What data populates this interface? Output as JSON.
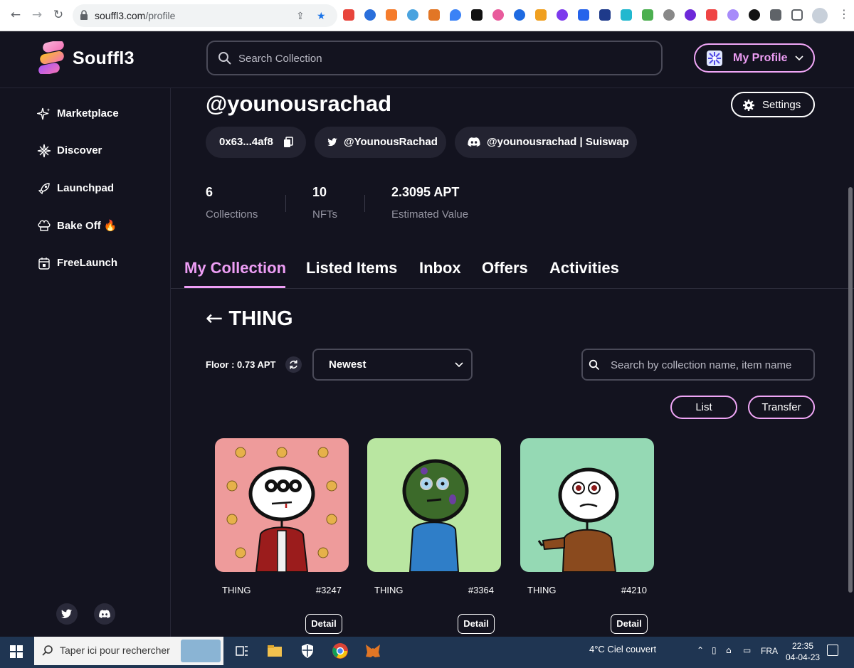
{
  "browser": {
    "url_host": "souffl3.com",
    "url_path": "/profile"
  },
  "header": {
    "logo_text": "Souffl3",
    "search_placeholder": "Search Collection",
    "profile_label": "My Profile"
  },
  "sidebar": {
    "items": [
      {
        "label": "Marketplace",
        "icon": "sparkle-icon"
      },
      {
        "label": "Discover",
        "icon": "compass-star-icon"
      },
      {
        "label": "Launchpad",
        "icon": "rocket-icon"
      },
      {
        "label": "Bake Off 🔥",
        "icon": "chef-hat-icon"
      },
      {
        "label": "FreeLaunch",
        "icon": "calendar-icon"
      }
    ]
  },
  "profile": {
    "username": "@younousrachad",
    "settings_label": "Settings",
    "address": "0x63...4af8",
    "twitter": "@YounousRachad",
    "discord": "@younousrachad | Suiswap",
    "stats": [
      {
        "value": "6",
        "label": "Collections"
      },
      {
        "value": "10",
        "label": "NFTs"
      },
      {
        "value": "2.3095 APT",
        "label": "Estimated Value"
      }
    ]
  },
  "tabs": [
    "My Collection",
    "Listed Items",
    "Inbox",
    "Offers",
    "Activities"
  ],
  "active_tab": "My Collection",
  "collection": {
    "title": "THING",
    "back_arrow": "←",
    "floor": "Floor : 0.73 APT",
    "sort_value": "Newest",
    "item_search_placeholder": "Search by collection name, item name",
    "list_label": "List",
    "transfer_label": "Transfer",
    "items": [
      {
        "name": "THING",
        "number": "#3247",
        "detail": "Detail",
        "bg": "#ee9b9b"
      },
      {
        "name": "THING",
        "number": "#3364",
        "detail": "Detail",
        "bg": "#b9e6a1"
      },
      {
        "name": "THING",
        "number": "#4210",
        "detail": "Detail",
        "bg": "#95d9b4"
      }
    ]
  },
  "taskbar": {
    "search_text": "Taper ici pour rechercher",
    "weather": "4°C  Ciel couvert",
    "lang": "FRA",
    "time": "22:35",
    "date": "04-04-23"
  },
  "colors": {
    "accent": "#ee9ef5",
    "background": "#13131f",
    "chip": "#232331"
  }
}
